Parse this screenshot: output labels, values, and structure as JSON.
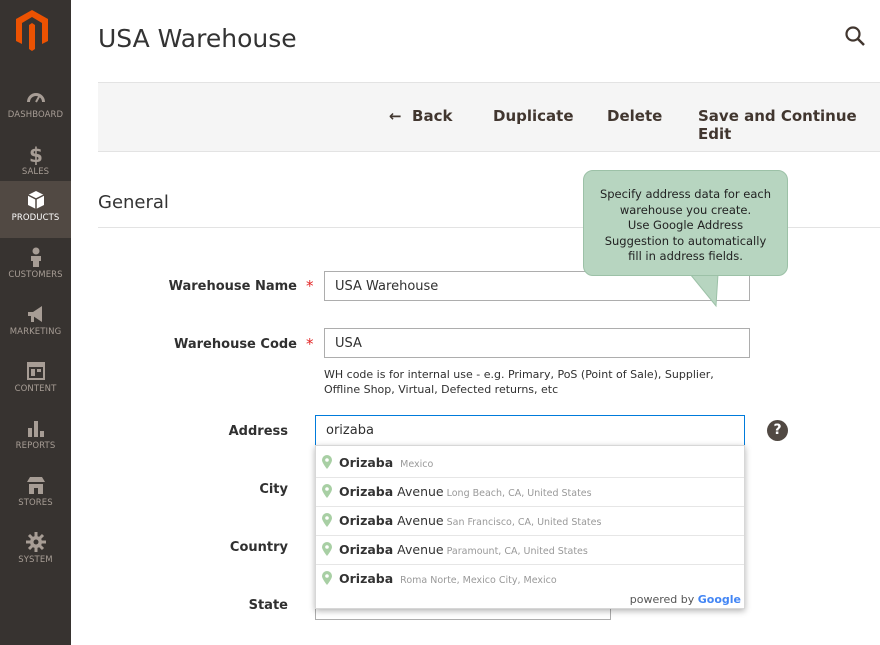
{
  "sidebar": {
    "items": [
      {
        "label": "DASHBOARD",
        "icon": "dashboard-icon"
      },
      {
        "label": "SALES",
        "icon": "dollar-icon"
      },
      {
        "label": "PRODUCTS",
        "icon": "cube-icon"
      },
      {
        "label": "CUSTOMERS",
        "icon": "person-icon"
      },
      {
        "label": "MARKETING",
        "icon": "megaphone-icon"
      },
      {
        "label": "CONTENT",
        "icon": "layout-icon"
      },
      {
        "label": "REPORTS",
        "icon": "bar-chart-icon"
      },
      {
        "label": "STORES",
        "icon": "storefront-icon"
      },
      {
        "label": "SYSTEM",
        "icon": "gear-icon"
      }
    ],
    "active": "PRODUCTS"
  },
  "header": {
    "title": "USA Warehouse"
  },
  "actions": {
    "back": "Back",
    "duplicate": "Duplicate",
    "delete": "Delete",
    "save_continue": "Save and Continue Edit"
  },
  "section": {
    "title": "General"
  },
  "form": {
    "warehouse_name": {
      "label": "Warehouse Name",
      "required": "*",
      "value": "USA Warehouse"
    },
    "warehouse_code": {
      "label": "Warehouse Code",
      "required": "*",
      "value": "USA",
      "note": "WH code is for internal use - e.g. Primary, PoS (Point of Sale), Supplier, Offline Shop, Virtual, Defected returns, etc"
    },
    "address": {
      "label": "Address",
      "value": "orizaba"
    },
    "city": {
      "label": "City"
    },
    "country": {
      "label": "Country"
    },
    "state": {
      "label": "State"
    }
  },
  "tooltip": {
    "line1": "Specify address data for each",
    "line2": "warehouse you create.",
    "line3": "Use Google Address",
    "line4": "Suggestion to automatically",
    "line5": "fill in address fields."
  },
  "help_icon": "?",
  "suggestions": [
    {
      "bold": "Orizaba",
      "rest": "",
      "secondary": "Mexico"
    },
    {
      "bold": "Orizaba",
      "rest": "Avenue",
      "secondary": "Long Beach, CA, United States"
    },
    {
      "bold": "Orizaba",
      "rest": "Avenue",
      "secondary": "San Francisco, CA, United States"
    },
    {
      "bold": "Orizaba",
      "rest": "Avenue",
      "secondary": "Paramount, CA, United States"
    },
    {
      "bold": "Orizaba",
      "rest": "",
      "secondary": "Roma Norte, Mexico City, Mexico"
    }
  ],
  "powered_by": {
    "prefix": "powered by",
    "brand": "Google"
  },
  "colors": {
    "sidebar": "#373330",
    "sidebar_active": "#514943",
    "brand_orange": "#eb5202",
    "tooltip": "#b7d5c0",
    "required": "#e22626"
  }
}
